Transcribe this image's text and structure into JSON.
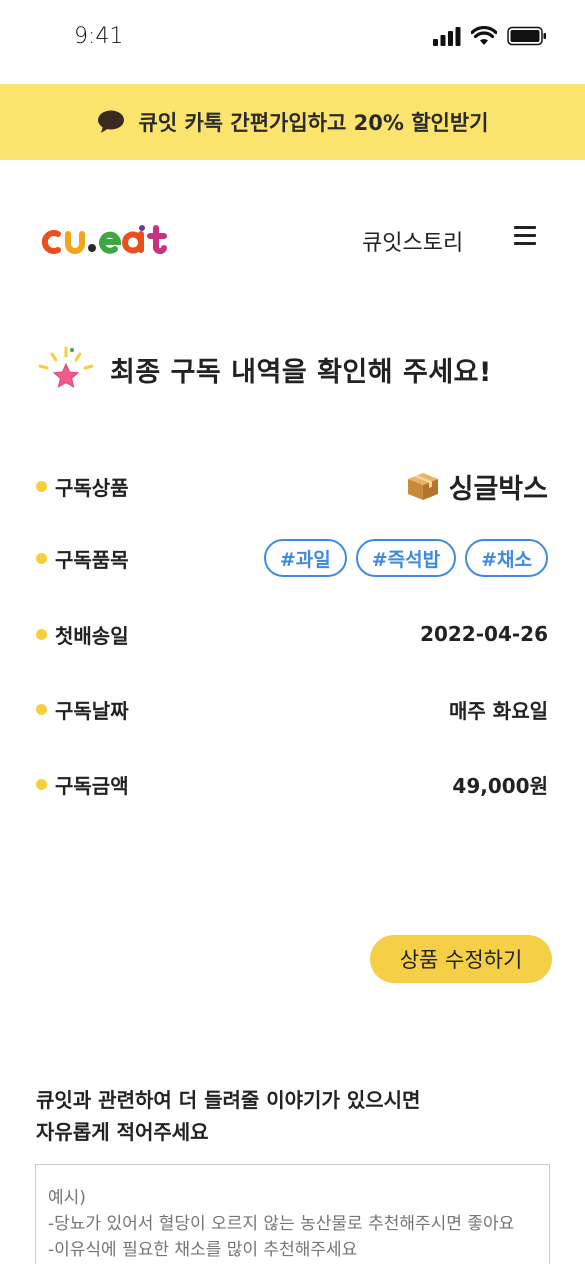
{
  "status_bar": {
    "time": "9:41"
  },
  "banner": {
    "text": "큐잇 카톡 간편가입하고 20% 할인받기",
    "icon": "chat-bubble-icon",
    "bg_color": "#fbe46e"
  },
  "header": {
    "logo_text": "cu.eat",
    "nav_story": "큐잇스토리",
    "menu_icon": "hamburger-menu-icon"
  },
  "page": {
    "title": "최종 구독 내역을 확인해 주세요!",
    "title_icon": "sparkle-star-icon"
  },
  "details": {
    "product": {
      "label": "구독상품",
      "value": "싱글박스",
      "icon": "box-icon"
    },
    "items": {
      "label": "구독품목",
      "tags": [
        "#과일",
        "#즉석밥",
        "#채소"
      ]
    },
    "first_delivery": {
      "label": "첫배송일",
      "value": "2022-04-26"
    },
    "schedule": {
      "label": "구독날짜",
      "value": "매주 화요일"
    },
    "price": {
      "label": "구독금액",
      "value": "49,000원"
    }
  },
  "actions": {
    "edit_label": "상품 수정하기"
  },
  "feedback": {
    "title_line1": "큐잇과 관련하여 더 들려줄 이야기가 있으시면",
    "title_line2": "자유롭게 적어주세요",
    "placeholder": "예시)\n-당뇨가 있어서 혈당이 오르지 않는 농산물로 추천해주시면 좋아요\n-이유식에 필요한 채소를 많이 추천해주세요"
  },
  "colors": {
    "accent_yellow": "#f5cf45",
    "tag_blue": "#3f8ae0",
    "dot_yellow": "#f5cf3c"
  }
}
